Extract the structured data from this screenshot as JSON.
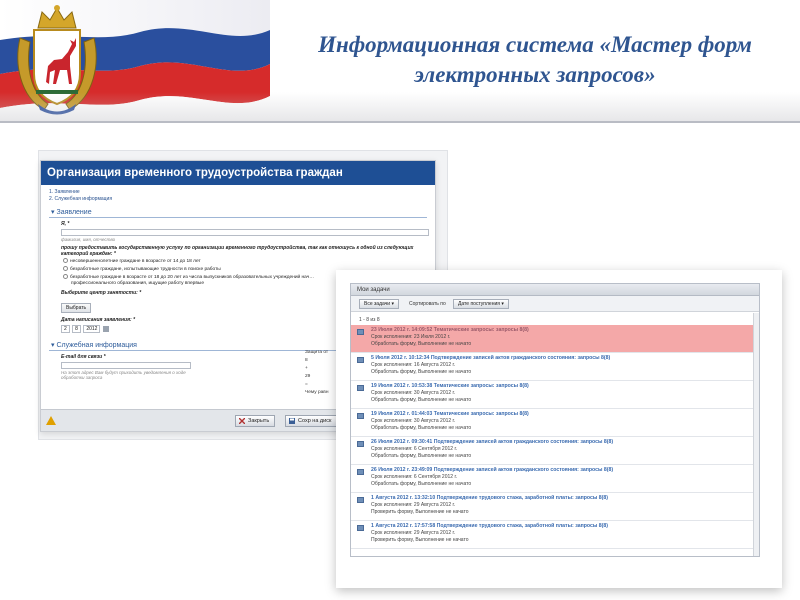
{
  "slide": {
    "title_line1": "Информационная система «Мастер форм",
    "title_line2": "электронных запросов»"
  },
  "colors": {
    "title": "#2f5590",
    "form_header": "#1e4f95",
    "task_link": "#3a6bb0",
    "task_highlight": "#f4a8a8",
    "flag_red": "#d62b2b",
    "flag_blue": "#2a4f9e"
  },
  "header": {
    "emblem_icon": "coat-of-arms-icon",
    "flag_icon": "russian-flag-icon"
  },
  "form": {
    "title": "Организация временного трудоустройства граждан",
    "steps": [
      "1. Заявление",
      "2. Служебная информация"
    ],
    "section_application": "Заявление",
    "fio_label": "Я, *",
    "fio_hint": "фамилия, имя, отчество",
    "request_label": "прошу предоставить государственную услугу по организации временного трудоустройства, так как отношусь к одной из следующих категорий граждан: *",
    "radio_options": [
      "несовершеннолетние граждане в возрасте от 14 до 18 лет",
      "безработные граждане, испытывающие трудности в поиске работы",
      "безработные граждане в возрасте от 18 до 20 лет из числа выпускников образовательных учреждений нач…",
      "профессионального образования, ищущие работу впервые"
    ],
    "center_label": "Выберите центр занятости: *",
    "choose_button": "Выбрать",
    "date_label": "Дата написания заявления: *",
    "date_day": "2",
    "date_month": "8",
    "date_year": "2012",
    "section_service": "Служебная информация",
    "email_label": "E-mail для связи *",
    "email_hint": "На этот адрес Вам будут приходить уведомления о ходе обработки запроса",
    "side_text": [
      "Защита от",
      "8",
      "+",
      "29",
      "=",
      "Чему равн"
    ],
    "close_button": "Закрыть",
    "save_button": "Сохр на диск"
  },
  "tasks": {
    "window_title": "Мои задачи",
    "filter_button": "Все задачи ▾",
    "sort_label": "Сортировать по",
    "sort_button": "Дате поступления ▾",
    "count": "1 - 8 из 8",
    "items": [
      {
        "title": "23 Июля 2012 г. 14:09:52 Тематические запросы: запросы 8(8)",
        "due": "Срок исполнения: 23 Июля 2012 г.",
        "status": "Обработать форму, Выполнение не начато",
        "highlight": true
      },
      {
        "title": "5 Июля 2012 г. 10:12:34 Подтверждение записей актов гражданского состояния: запросы 8(8)",
        "due": "Срок исполнения: 16 Августа 2012 г.",
        "status": "Обработать форму, Выполнение не начато",
        "highlight": false
      },
      {
        "title": "19 Июля 2012 г. 10:53:38 Тематические запросы: запросы 8(8)",
        "due": "Срок исполнения: 30 Августа 2012 г.",
        "status": "Обработать форму, Выполнение не начато",
        "highlight": false
      },
      {
        "title": "19 Июля 2012 г. 01:44:03 Тематические запросы: запросы 8(8)",
        "due": "Срок исполнения: 30 Августа 2012 г.",
        "status": "Обработать форму, Выполнение не начато",
        "highlight": false
      },
      {
        "title": "26 Июля 2012 г. 09:30:41 Подтверждение записей актов гражданского состояния: запросы 8(8)",
        "due": "Срок исполнения: 6 Сентября 2012 г.",
        "status": "Обработать форму, Выполнение не начато",
        "highlight": false
      },
      {
        "title": "26 Июля 2012 г. 23:49:09 Подтверждение записей актов гражданского состояния: запросы 8(8)",
        "due": "Срок исполнения: 6 Сентября 2012 г.",
        "status": "Обработать форму, Выполнение не начато",
        "highlight": false
      },
      {
        "title": "1 Августа 2012 г. 13:32:10 Подтверждение трудового стажа, заработной платы: запросы 8(8)",
        "due": "Срок исполнения: 29 Августа 2012 г.",
        "status": "Проверить форму, Выполнение не начато",
        "highlight": false
      },
      {
        "title": "1 Августа 2012 г. 17:57:58 Подтверждение трудового стажа, заработной платы: запросы 8(8)",
        "due": "Срок исполнения: 29 Августа 2012 г.",
        "status": "Проверить форму, Выполнение не начато",
        "highlight": false
      }
    ]
  }
}
